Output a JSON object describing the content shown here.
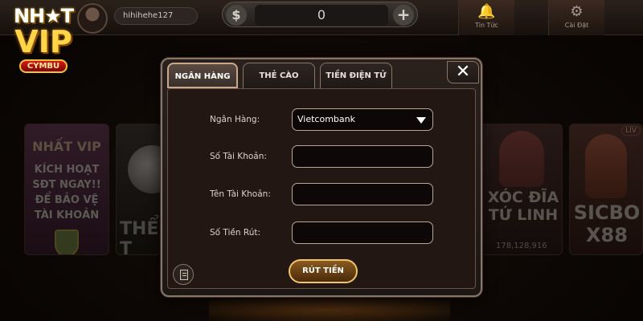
{
  "brand": {
    "logo_top": "NH★T",
    "logo_vip": "VIP",
    "logo_badge": "CYMBU"
  },
  "user": {
    "username": "hihihehe127"
  },
  "balance": {
    "currency_symbol": "$",
    "value": "0",
    "plus": "+"
  },
  "top_nav": {
    "news_label": "Tin Tức",
    "news_icon": "bell-icon",
    "settings_label": "Cài Đặt",
    "settings_icon": "gear-icon"
  },
  "background_games": {
    "promo": {
      "logo": "NHẤT VIP",
      "text_lines": [
        "KÍCH HOẠT",
        "SĐT NGAY!!",
        "ĐỂ BẢO VỆ",
        "TÀI KHOẢN"
      ]
    },
    "sport": {
      "title": "THỂ T"
    },
    "xocdia": {
      "title_line1": "XÓC ĐĨA",
      "title_line2": "TỨ LINH",
      "jackpot": "178,128,916"
    },
    "sicbo": {
      "live": "LIV",
      "title_line1": "SICBO",
      "title_line2": "X88"
    }
  },
  "dialog": {
    "tabs": [
      {
        "label": "NGÂN HÀNG",
        "active": true
      },
      {
        "label": "THẺ CÀO",
        "active": false
      },
      {
        "label": "TIỀN ĐIỆN TỬ",
        "active": false
      }
    ],
    "close_label": "✕",
    "form": {
      "bank_label": "Ngân Hàng:",
      "bank_value": "Vietcombank",
      "account_number_label": "Số Tài Khoản:",
      "account_number_value": "",
      "account_name_label": "Tên Tài Khoản:",
      "account_name_value": "",
      "amount_label": "Số Tiền Rút:",
      "amount_value": ""
    },
    "submit_label": "RÚT TIỀN"
  },
  "colors": {
    "accent_gold": "#f0c46a",
    "dialog_border": "#8a7666",
    "field_border": "#b9a796"
  }
}
